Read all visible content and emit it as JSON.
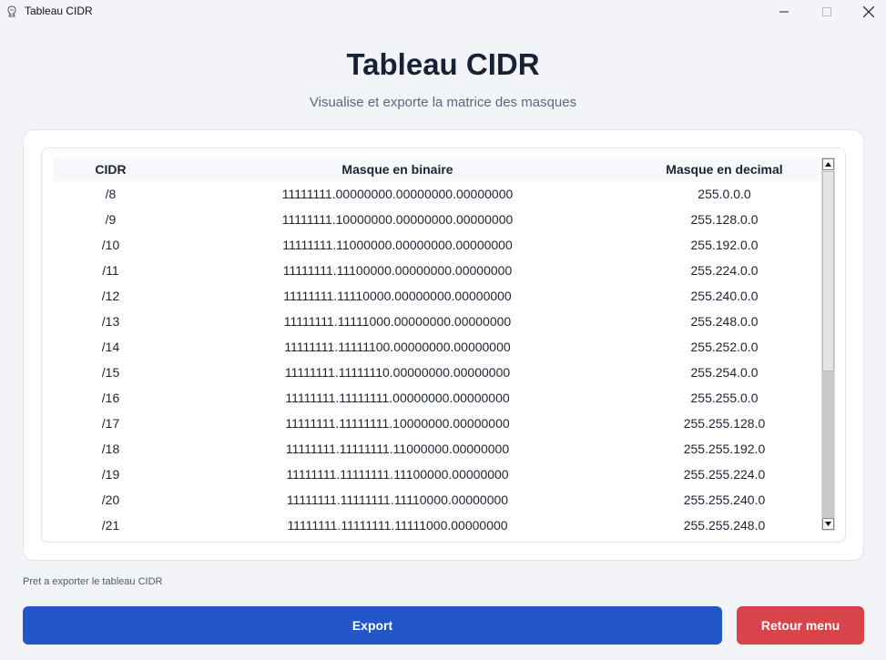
{
  "window": {
    "title": "Tableau CIDR",
    "controls": [
      "minimize-icon",
      "maximize-icon",
      "close-icon"
    ]
  },
  "header": {
    "title": "Tableau CIDR",
    "subtitle": "Visualise et exporte la matrice des masques"
  },
  "table": {
    "columns": [
      "CIDR",
      "Masque en binaire",
      "Masque en decimal"
    ],
    "rows": [
      {
        "cidr": "/8",
        "binary": "11111111.00000000.00000000.00000000",
        "decimal": "255.0.0.0"
      },
      {
        "cidr": "/9",
        "binary": "11111111.10000000.00000000.00000000",
        "decimal": "255.128.0.0"
      },
      {
        "cidr": "/10",
        "binary": "11111111.11000000.00000000.00000000",
        "decimal": "255.192.0.0"
      },
      {
        "cidr": "/11",
        "binary": "11111111.11100000.00000000.00000000",
        "decimal": "255.224.0.0"
      },
      {
        "cidr": "/12",
        "binary": "11111111.11110000.00000000.00000000",
        "decimal": "255.240.0.0"
      },
      {
        "cidr": "/13",
        "binary": "11111111.11111000.00000000.00000000",
        "decimal": "255.248.0.0"
      },
      {
        "cidr": "/14",
        "binary": "11111111.11111100.00000000.00000000",
        "decimal": "255.252.0.0"
      },
      {
        "cidr": "/15",
        "binary": "11111111.11111110.00000000.00000000",
        "decimal": "255.254.0.0"
      },
      {
        "cidr": "/16",
        "binary": "11111111.11111111.00000000.00000000",
        "decimal": "255.255.0.0"
      },
      {
        "cidr": "/17",
        "binary": "11111111.11111111.10000000.00000000",
        "decimal": "255.255.128.0"
      },
      {
        "cidr": "/18",
        "binary": "11111111.11111111.11000000.00000000",
        "decimal": "255.255.192.0"
      },
      {
        "cidr": "/19",
        "binary": "11111111.11111111.11100000.00000000",
        "decimal": "255.255.224.0"
      },
      {
        "cidr": "/20",
        "binary": "11111111.11111111.11110000.00000000",
        "decimal": "255.255.240.0"
      },
      {
        "cidr": "/21",
        "binary": "11111111.11111111.11111000.00000000",
        "decimal": "255.255.248.0"
      }
    ]
  },
  "status": {
    "text": "Pret a exporter le tableau CIDR"
  },
  "actions": {
    "export_label": "Export",
    "back_label": "Retour menu"
  },
  "colors": {
    "export_button": "#2357c9",
    "back_button": "#d9434a",
    "title": "#182236"
  }
}
